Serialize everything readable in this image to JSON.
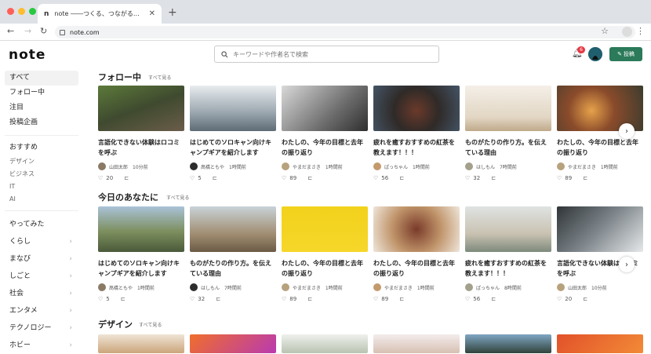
{
  "browser": {
    "tab_title": "note ――つくる、つながる…",
    "tab_favicon": "n",
    "tab_close": "✕",
    "new_tab": "+",
    "url": "note.com"
  },
  "header": {
    "logo": "note",
    "search_placeholder": "キーワードや作者名で検索",
    "notification_count": "6",
    "post_button": "投稿"
  },
  "sidebar": {
    "top": [
      "すべて",
      "フォロー中",
      "注目",
      "投稿企画"
    ],
    "recommend": "おすすめ",
    "recommend_sub": [
      "デザイン",
      "ビジネス",
      "IT",
      "AI"
    ],
    "categories": [
      "やってみた",
      "くらし",
      "まなび",
      "しごと",
      "社会",
      "エンタメ",
      "テクノロジー",
      "ホビー"
    ]
  },
  "sections": [
    {
      "title": "フォロー中",
      "see_all": "すべて見る",
      "cards": [
        {
          "title": "言語化できない体験はロコミを呼ぶ",
          "author": "山田太郎",
          "time": "10分前",
          "likes": "20"
        },
        {
          "title": "はじめてのソロキャン向けキャンプギアを紹介します",
          "author": "髙橋ともや",
          "time": "1時間前",
          "likes": "5"
        },
        {
          "title": "わたしの、今年の目標と去年の振り返り",
          "author": "やまだまさき",
          "time": "1時間前",
          "likes": "89"
        },
        {
          "title": "疲れを癒すおすすめの紅茶を教えます！！！",
          "author": "ぱっちゃん",
          "time": "1時間前",
          "likes": "56"
        },
        {
          "title": "ものがたりの作り方。を伝えている理由",
          "author": "はしもん",
          "time": "7時間前",
          "likes": "32"
        },
        {
          "title": "わたしの、今年の目標と去年の振り返り",
          "author": "やまだまさき",
          "time": "1時間前",
          "likes": "89"
        }
      ]
    },
    {
      "title": "今日のあなたに",
      "see_all": "すべて見る",
      "cards": [
        {
          "title": "はじめてのソロキャン向けキャンプギアを紹介します",
          "author": "髙橋ともや",
          "time": "1時間前",
          "likes": "5"
        },
        {
          "title": "ものがたりの作り方。を伝えている理由",
          "author": "はしもん",
          "time": "7時間前",
          "likes": "32"
        },
        {
          "title": "わたしの、今年の目標と去年の振り返り",
          "author": "やまだまさき",
          "time": "1時間前",
          "likes": "89"
        },
        {
          "title": "わたしの、今年の目標と去年の振り返り",
          "author": "やまだまさき",
          "time": "1時間前",
          "likes": "89"
        },
        {
          "title": "疲れを癒すおすすめの紅茶を教えます！！！",
          "author": "ぱっちゃん",
          "time": "8時間前",
          "likes": "56"
        },
        {
          "title": "言語化できない体験はロコミを呼ぶ",
          "author": "山田太郎",
          "time": "10分前",
          "likes": "20"
        }
      ]
    },
    {
      "title": "デザイン",
      "see_all": "すべて見る"
    }
  ],
  "colors": {
    "accent": "#2b7a5a",
    "badge": "#e63946"
  },
  "icons": [
    "search-icon",
    "bell-icon",
    "heart-icon",
    "bookmark-icon",
    "chevron-right-icon",
    "pencil-icon"
  ]
}
